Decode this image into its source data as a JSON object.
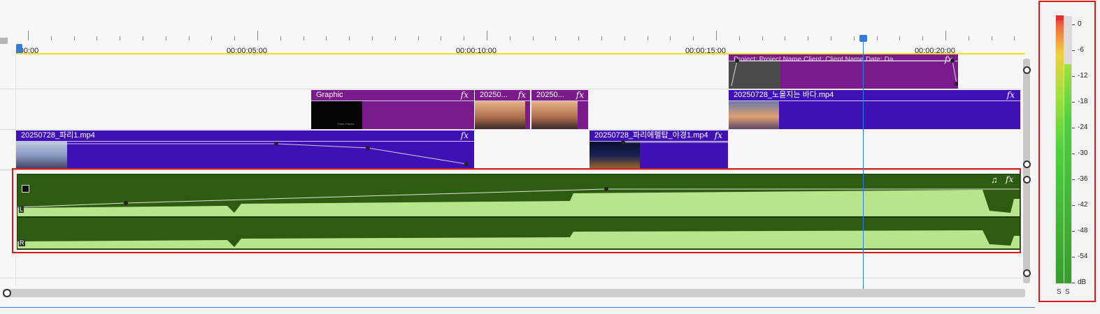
{
  "ruler": {
    "marks": [
      ":00:00",
      "00:00:05:00",
      "00:00:10:00",
      "00:00:15:00",
      "00:00:20:00"
    ]
  },
  "tracks": {
    "overlay_clip": {
      "title": "Project:   Project Name Client:             Client Name Date:   Da...",
      "fx": "fx"
    },
    "v2_clips": [
      {
        "title": "Graphic",
        "fx": "fx",
        "thumb_caption": "Paris, France"
      },
      {
        "title": "20250...",
        "fx": "fx"
      },
      {
        "title": "20250...",
        "fx": "fx"
      },
      {
        "title": "20250728_노을지는 바다.mp4",
        "fx": "fx"
      }
    ],
    "v1_clips": [
      {
        "title": "20250728_파리1.mp4",
        "fx": "fx"
      },
      {
        "title": "20250728_파리에펠탑_야경1.mp4",
        "fx": "fx"
      }
    ],
    "audio_clip": {
      "channel_left": "L",
      "channel_right": "R",
      "music_icon": "♫",
      "fx": "fx"
    }
  },
  "meter": {
    "scale": [
      "0",
      "-6",
      "-12",
      "-18",
      "-24",
      "-30",
      "-36",
      "-42",
      "-48",
      "-54",
      "dB"
    ],
    "bottom_labels": [
      "S",
      "S"
    ],
    "level_db": -12
  },
  "colors": {
    "video_clip": "#3e10b5",
    "graphic_clip": "#7b1a8a",
    "audio_dark": "#2e5b12",
    "audio_light": "#b8e48c",
    "playhead": "#2f7de1",
    "highlight": "#e01818",
    "loop_bar": "#f0e020"
  },
  "icons": [
    "playhead-marker-icon",
    "fx-icon",
    "music-note-icon",
    "scroll-handle-icon"
  ]
}
